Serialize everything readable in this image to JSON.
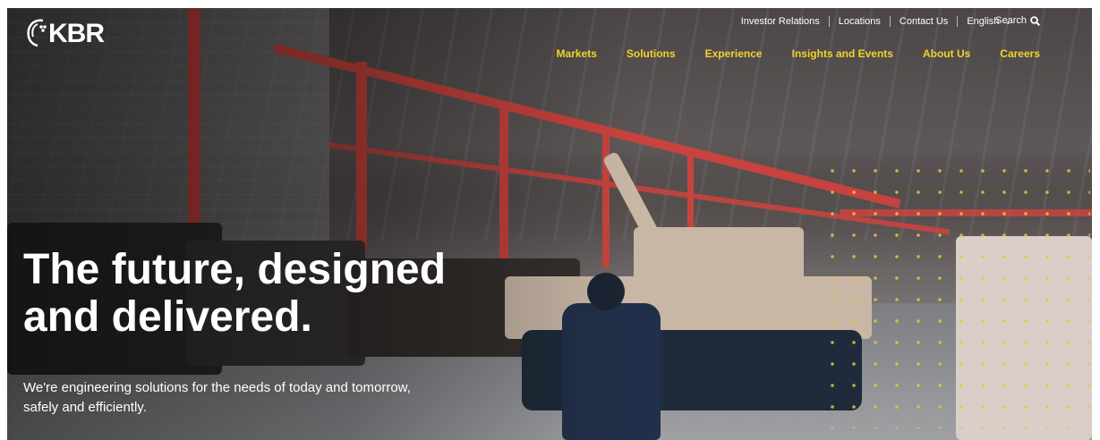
{
  "brand": {
    "name": "KBR"
  },
  "utility_nav": {
    "items": [
      "Investor Relations",
      "Locations",
      "Contact Us",
      "English"
    ],
    "search_label": "Search"
  },
  "main_nav": {
    "items": [
      "Markets",
      "Solutions",
      "Experience",
      "Insights and Events",
      "About Us",
      "Careers"
    ]
  },
  "hero": {
    "headline_line1": "The future, designed",
    "headline_line2": "and delivered.",
    "subtext_line1": "We're engineering solutions for the needs of today and tomorrow,",
    "subtext_line2": "safely and efficiently."
  },
  "colors": {
    "nav_accent": "#f2d12e",
    "steel_red": "#c9433e",
    "text": "#ffffff"
  },
  "icons": [
    "kbr-logo-icon",
    "chevron-down-icon",
    "search-icon"
  ]
}
